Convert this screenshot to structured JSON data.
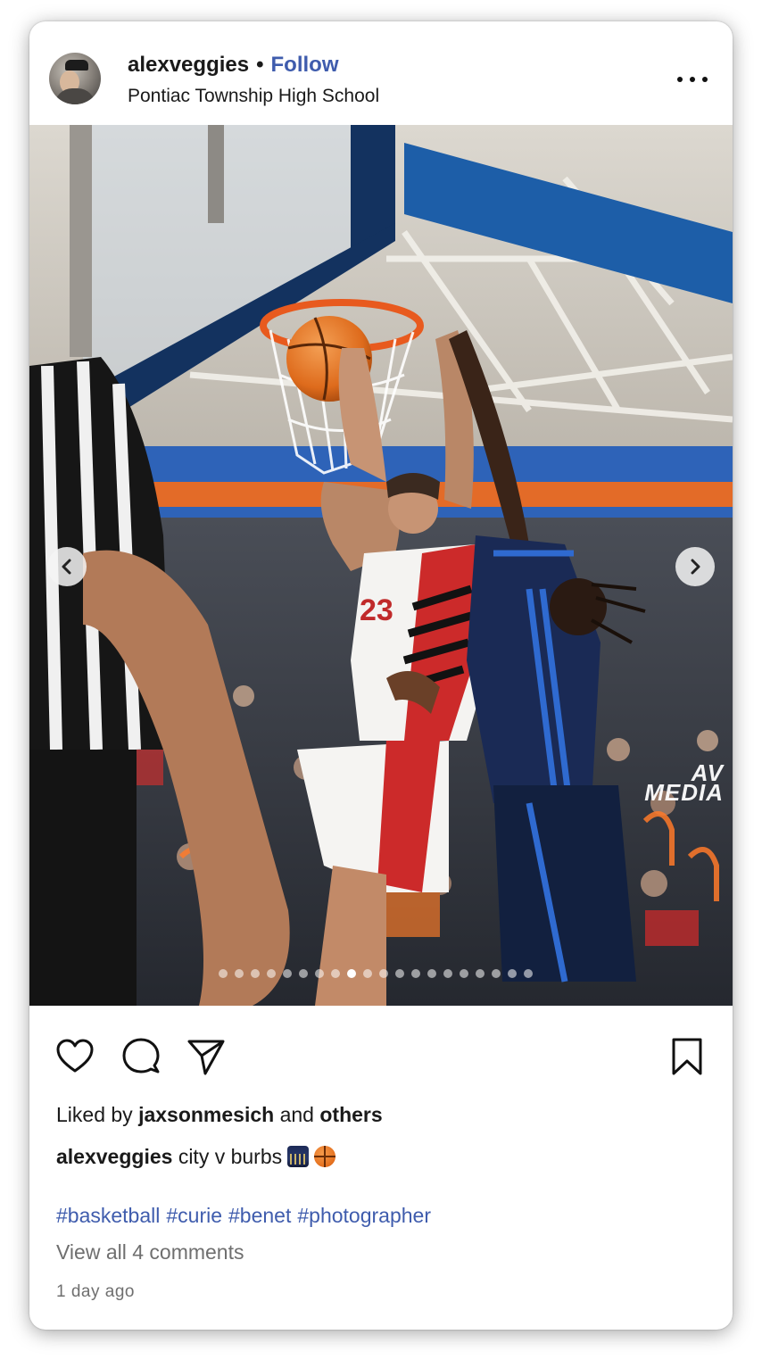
{
  "post": {
    "username": "alexveggies",
    "separator": "•",
    "follow_label": "Follow",
    "location": "Pontiac Township High School",
    "more_icon": "more-horizontal-icon"
  },
  "photo": {
    "watermark_line1": "AV",
    "watermark_line2": "MEDIA",
    "carousel": {
      "total": 20,
      "active_index": 8
    },
    "prev_icon": "chevron-left-icon",
    "next_icon": "chevron-right-icon"
  },
  "actions": {
    "like_icon": "heart-icon",
    "comment_icon": "comment-icon",
    "share_icon": "send-icon",
    "save_icon": "bookmark-icon"
  },
  "likes": {
    "prefix": "Liked by",
    "user": "jaxsonmesich",
    "middle": "and",
    "others": "others"
  },
  "caption": {
    "username": "alexveggies",
    "text": "city v burbs",
    "emojis": [
      "night-city-emoji",
      "basketball-emoji"
    ]
  },
  "hashtags": [
    "#basketball",
    "#curie",
    "#benet",
    "#photographer"
  ],
  "comments_link": "View all 4 comments",
  "timestamp": "1 day ago",
  "colors": {
    "link_blue": "#3f5cad",
    "muted_gray": "#6f6f6f",
    "text": "#1a1a1a"
  }
}
